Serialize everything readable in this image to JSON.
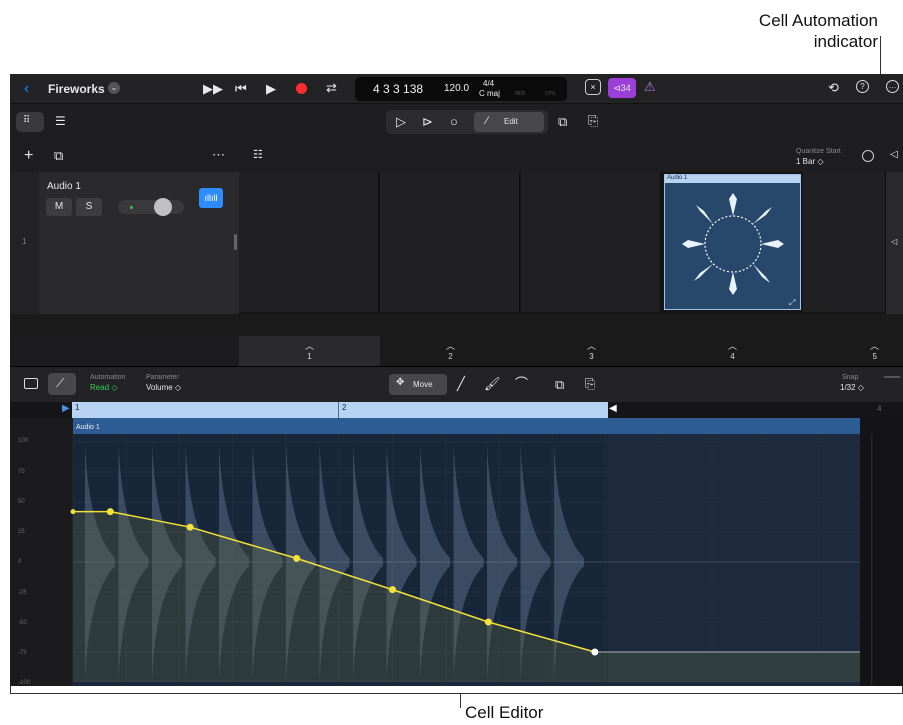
{
  "callouts": {
    "cell_automation": "Cell Automation\nindicator",
    "cell_editor": "Cell Editor"
  },
  "toolbar": {
    "project_name": "Fireworks",
    "lcd": {
      "position": "4 3 3 138",
      "tempo": "120.0",
      "signature": "4/4",
      "key": "C maj",
      "midi": "MIDI",
      "cpu": "CPU"
    },
    "count_in": "⊲34"
  },
  "edit_tools": {
    "edit_label": "Edit"
  },
  "grid": {
    "quantize_label": "Quantize Start",
    "quantize_value": "1 Bar ◇"
  },
  "track": {
    "name": "Audio 1",
    "mute": "M",
    "solo": "S",
    "number": "1"
  },
  "cell": {
    "name": "Audio 1"
  },
  "scenes": [
    "1",
    "2",
    "3",
    "4",
    "5"
  ],
  "editor": {
    "automation_label": "Automation",
    "automation_value": "Read ◇",
    "parameter_label": "Parameter",
    "parameter_value": "Volume ◇",
    "move_label": "Move",
    "snap_label": "Snap",
    "snap_value": "1/32 ◇",
    "region_name": "Audio 1",
    "ruler_marks": [
      "1",
      "2",
      "4"
    ]
  },
  "automation_scale": [
    "100",
    "75",
    "50",
    "25",
    "0",
    "-25",
    "-50",
    "-75",
    "-100"
  ],
  "automation_points": [
    {
      "beat": 0,
      "value": 42
    },
    {
      "beat": 0.35,
      "value": 42
    },
    {
      "beat": 1.1,
      "value": 29
    },
    {
      "beat": 2.1,
      "value": 3
    },
    {
      "beat": 3.0,
      "value": -23
    },
    {
      "beat": 3.9,
      "value": -50
    },
    {
      "beat": 4.9,
      "value": -75
    }
  ],
  "colors": {
    "accent_blue": "#0a84ff",
    "automation_yellow": "#f2e23a",
    "record_red": "#ff2d2d",
    "count_in_purple": "#9b3fd9",
    "cell_blue": "#27476b"
  }
}
